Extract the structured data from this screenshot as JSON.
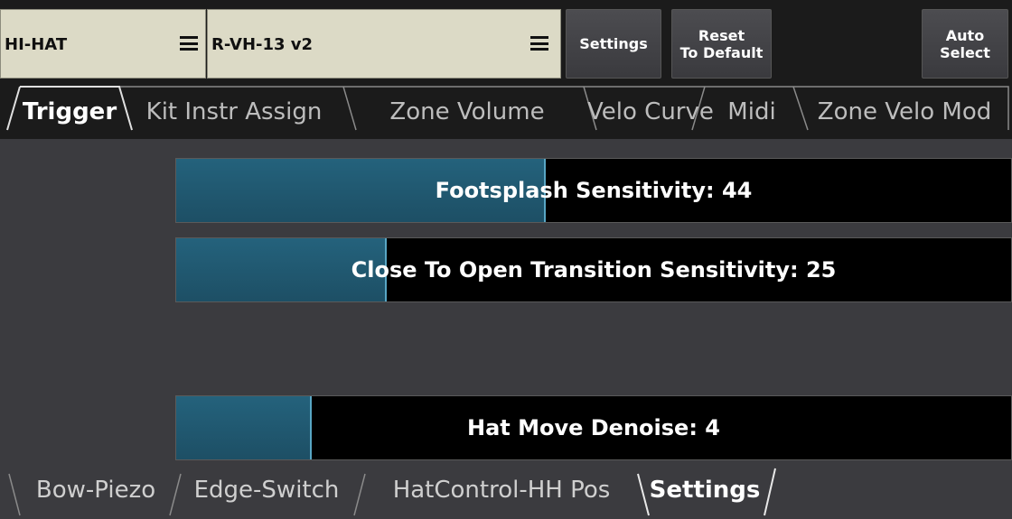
{
  "top_bar": {
    "instrument_selector": {
      "value": "HI-HAT",
      "icon": "hamburger-menu-icon"
    },
    "trigger_selector": {
      "value": "R-VH-13 v2",
      "icon": "hamburger-menu-icon"
    },
    "settings_button": "Settings",
    "reset_button": {
      "line1": "Reset",
      "line2": "To Default"
    },
    "auto_select_button": {
      "line1": "Auto",
      "line2": "Select"
    }
  },
  "main_tabs": [
    {
      "label": "Trigger",
      "active": true
    },
    {
      "label": "Kit Instr Assign",
      "active": false
    },
    {
      "label": "Zone Volume",
      "active": false
    },
    {
      "label": "Velo Curve",
      "active": false
    },
    {
      "label": "Midi",
      "active": false
    },
    {
      "label": "Zone Velo Mod",
      "active": false
    }
  ],
  "sliders": [
    {
      "label": "Footsplash Sensitivity: 44",
      "value": 44,
      "max": 100
    },
    {
      "label": "Close To Open Transition Sensitivity: 25",
      "value": 25,
      "max": 100
    },
    {
      "label": "Hat Move Denoise: 4",
      "value": 4,
      "max": 25
    }
  ],
  "sub_tabs": [
    {
      "label": "Bow-Piezo",
      "active": false
    },
    {
      "label": "Edge-Switch",
      "active": false
    },
    {
      "label": "HatControl-HH Pos",
      "active": false
    },
    {
      "label": "Settings",
      "active": true
    }
  ],
  "colors": {
    "background": "#3b3b3f",
    "header": "#1b1b1b",
    "selector": "#dcdac6",
    "slider_fill": "#24627c",
    "slider_track": "#000000"
  }
}
